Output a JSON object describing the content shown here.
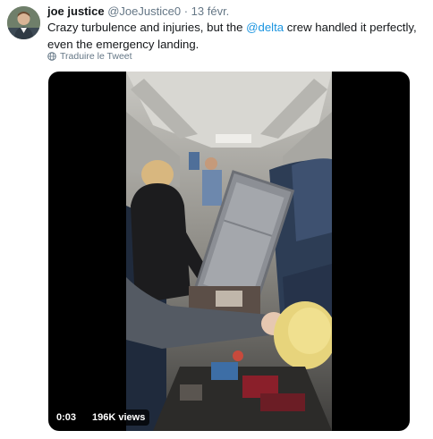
{
  "tweet": {
    "author_name": "joe justice",
    "handle": "@JoeJustice0",
    "separator": "·",
    "time": "13 févr.",
    "text_before": "Crazy turbulence and injuries, but the ",
    "mention": "@delta",
    "text_after": " crew handled it perfectly, even the emergency landing.",
    "translate_label": "Traduire le Tweet",
    "translate_icon": "globe-icon"
  },
  "video": {
    "timestamp": "0:03",
    "views": "196K views"
  },
  "colors": {
    "link": "#1b95e0",
    "secondary_text": "#657786",
    "video_background": "#000000"
  }
}
